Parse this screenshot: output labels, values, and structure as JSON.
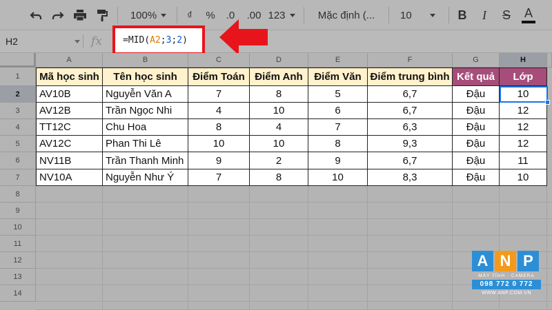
{
  "toolbar": {
    "zoom": "100%",
    "currency": "₫",
    "percent": "%",
    "dec_decrease": ".0",
    "dec_increase": ".00",
    "more_formats": "123",
    "font_name": "Mặc định (...",
    "font_size": "10",
    "bold": "B",
    "italic": "I",
    "strike": "S",
    "text_color": "A"
  },
  "formula_bar": {
    "name_box": "H2",
    "fx_label": "fx",
    "formula": {
      "fn": "=MID(",
      "ref": "A2",
      "sep1": ";",
      "arg2": "3",
      "sep2": ";",
      "arg3": "2",
      "close": ")"
    }
  },
  "columns": [
    "A",
    "B",
    "C",
    "D",
    "E",
    "F",
    "G",
    "H"
  ],
  "rows": [
    "1",
    "2",
    "3",
    "4",
    "5",
    "6",
    "7",
    "8",
    "9",
    "10",
    "11",
    "12",
    "13",
    "14"
  ],
  "selected_cell": "H2",
  "table": {
    "headers": [
      "Mã học sinh",
      "Tên học sinh",
      "Điểm Toán",
      "Điểm Anh",
      "Điểm Văn",
      "Điểm trung bình",
      "Kết quả",
      "Lớp"
    ],
    "rows": [
      [
        "AV10B",
        "Nguyễn Văn A",
        "7",
        "8",
        "5",
        "6,7",
        "Đậu",
        "10"
      ],
      [
        "AV12B",
        "Trần Ngọc Nhi",
        "4",
        "10",
        "6",
        "6,7",
        "Đậu",
        "12"
      ],
      [
        "TT12C",
        "Chu Hoa",
        "8",
        "4",
        "7",
        "6,3",
        "Đậu",
        "12"
      ],
      [
        "AV12C",
        "Phan Thi Lê",
        "10",
        "10",
        "8",
        "9,3",
        "Đậu",
        "12"
      ],
      [
        "NV11B",
        "Trần Thanh Minh",
        "9",
        "2",
        "9",
        "6,7",
        "Đậu",
        "11"
      ],
      [
        "NV10A",
        "Nguyễn Như Ý",
        "7",
        "8",
        "10",
        "8,3",
        "Đậu",
        "10"
      ]
    ]
  },
  "logo": {
    "letters": [
      "A",
      "N",
      "P"
    ],
    "tagline": "MÁY TÍNH · CAMERA",
    "phone": "098 772 0 772",
    "website": "WWW.ANP.COM.VN"
  },
  "colors": {
    "header_fill": "#fff2cc",
    "highlight_header_fill": "#a64d79",
    "annotation_red": "#e8141c",
    "selection_blue": "#1a73e8",
    "formula_ref_orange": "#e37400",
    "formula_num_blue": "#1155cc"
  }
}
